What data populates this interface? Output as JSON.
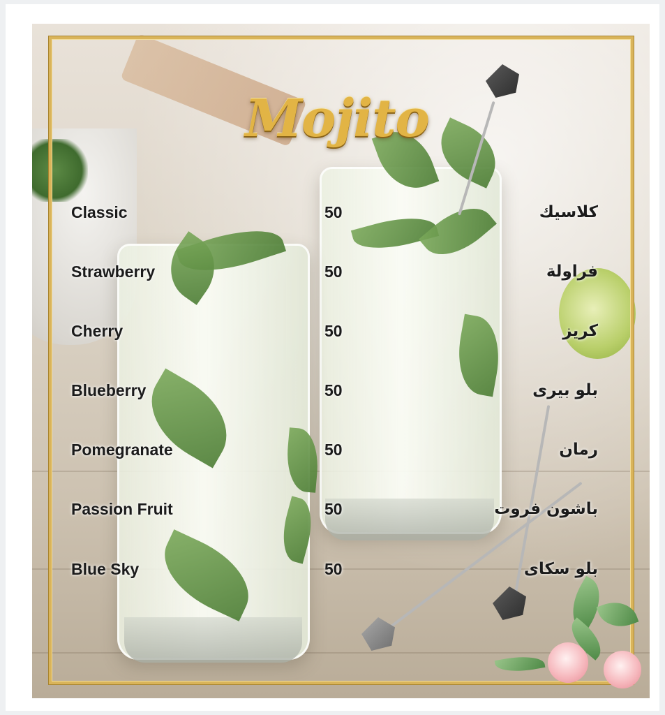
{
  "menu": {
    "title": "Mojito",
    "items": [
      {
        "name_en": "Classic",
        "price": "50",
        "name_ar": "كلاسيك"
      },
      {
        "name_en": "Strawberry",
        "price": "50",
        "name_ar": "فراولة"
      },
      {
        "name_en": "Cherry",
        "price": "50",
        "name_ar": "كريز"
      },
      {
        "name_en": "Blueberry",
        "price": "50",
        "name_ar": "بلو بيرى"
      },
      {
        "name_en": "Pomegranate",
        "price": "50",
        "name_ar": "رمان"
      },
      {
        "name_en": "Passion Fruit",
        "price": "50",
        "name_ar": "باشون فروت"
      },
      {
        "name_en": "Blue Sky",
        "price": "50",
        "name_ar": "بلو سكاى"
      }
    ]
  },
  "colors": {
    "frame_gold": "#d9b45a",
    "title_gold": "#e2b445",
    "text": "#1b1b1b"
  }
}
